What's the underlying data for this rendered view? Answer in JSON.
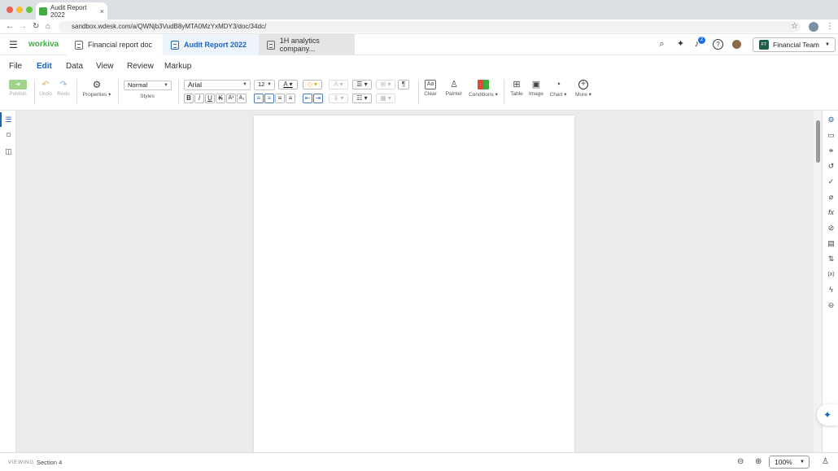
{
  "browser": {
    "tab_title": "Audit Report 2022",
    "tab_close": "×",
    "url": "sandbox.wdesk.com/a/QWNjb3VudB8yMTA0MzYxMDY3/doc/34dc/"
  },
  "app": {
    "logo": "workiva",
    "doc_tabs": [
      "Financial report doc",
      "Audit Report 2022",
      "1H analytics company..."
    ],
    "notification_count": "2",
    "team_initials": "FT",
    "team_label": "Financial Team"
  },
  "menu": [
    "File",
    "Edit",
    "Data",
    "View",
    "Review",
    "Markup"
  ],
  "toolbar": {
    "publish": "Publish",
    "undo": "Undo",
    "redo": "Redo",
    "properties": "Properties",
    "style_value": "Normal",
    "styles": "Styles",
    "font_value": "Arial",
    "font_size": "12",
    "clear": "Clear",
    "painter": "Painter",
    "conditions": "Conditions",
    "table": "Table",
    "image": "Image",
    "chart": "Chart",
    "more": "More"
  },
  "status": {
    "mode": "VIEWING",
    "section": "Section 4",
    "zoom": "100%"
  },
  "colors": {
    "accent": "#1a63c0",
    "brand_green": "#3fae3f",
    "notification": "#1e6fd9"
  }
}
